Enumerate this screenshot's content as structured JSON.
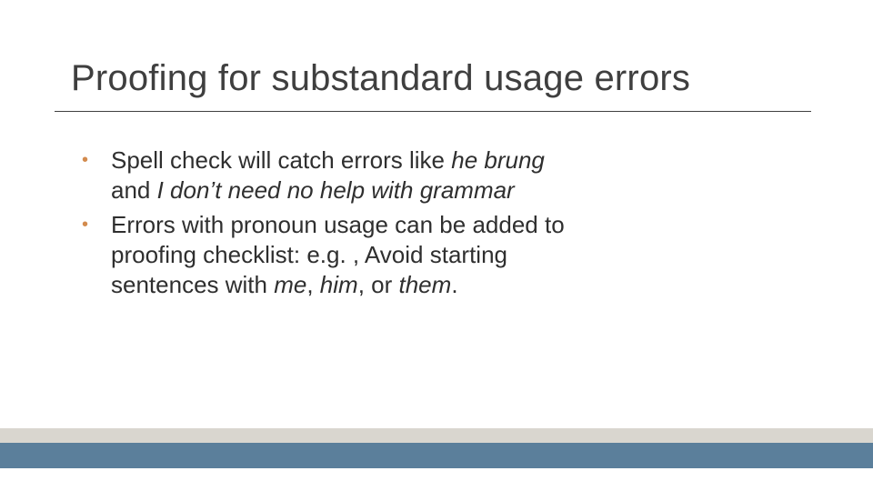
{
  "colors": {
    "bullet_accent": "#d38b4e",
    "rule": "#3f3f3f",
    "band_top": "#d9d6cf",
    "band_bottom": "#5b7f9b",
    "title_text": "#3f3f3f",
    "body_text": "#2f2f2f"
  },
  "title": "Proofing for substandard usage errors",
  "bullets": [
    {
      "segments": [
        {
          "t": "Spell check will catch errors like ",
          "i": false
        },
        {
          "t": "he brung",
          "i": true
        },
        {
          "t": " and ",
          "i": false
        },
        {
          "t": "I don’t need no help with grammar",
          "i": true
        }
      ]
    },
    {
      "segments": [
        {
          "t": "Errors with pronoun usage can be added to proofing checklist: e.g. , Avoid starting sentences with ",
          "i": false
        },
        {
          "t": "me",
          "i": true
        },
        {
          "t": ", ",
          "i": false
        },
        {
          "t": "him",
          "i": true
        },
        {
          "t": ", or ",
          "i": false
        },
        {
          "t": "them",
          "i": true
        },
        {
          "t": ".",
          "i": false
        }
      ]
    }
  ]
}
